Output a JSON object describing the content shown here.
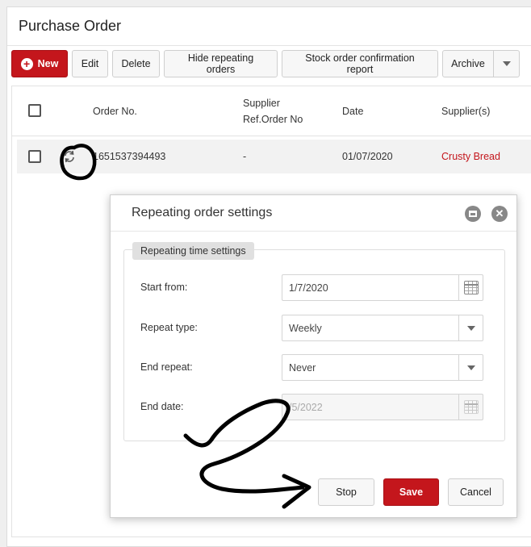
{
  "page": {
    "title": "Purchase Order"
  },
  "toolbar": {
    "new_label": "New",
    "edit_label": "Edit",
    "delete_label": "Delete",
    "hide_repeating_label": "Hide repeating orders",
    "stock_report_label": "Stock order confirmation report",
    "archive_label": "Archive"
  },
  "grid": {
    "columns": {
      "order_no": "Order No.",
      "supplier_ref_line1": "Supplier",
      "supplier_ref_line2": "Ref.Order No",
      "date": "Date",
      "suppliers": "Supplier(s)"
    },
    "rows": [
      {
        "order_no": "1651537394493",
        "supplier_ref": "-",
        "date": "01/07/2020",
        "supplier": "Crusty Bread"
      }
    ]
  },
  "dialog": {
    "title": "Repeating order settings",
    "section_label": "Repeating time settings",
    "fields": {
      "start_from": {
        "label": "Start from:",
        "value": "1/7/2020"
      },
      "repeat_type": {
        "label": "Repeat type:",
        "value": "Weekly"
      },
      "end_repeat": {
        "label": "End repeat:",
        "value": "Never"
      },
      "end_date": {
        "label": "End date:",
        "value": "/5/2022"
      }
    },
    "buttons": {
      "stop": "Stop",
      "save": "Save",
      "cancel": "Cancel"
    }
  },
  "colors": {
    "accent": "#c4161c",
    "supplier_text": "#c4161c"
  }
}
